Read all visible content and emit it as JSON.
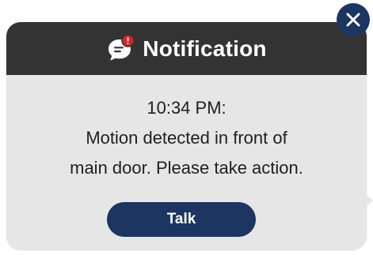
{
  "notification": {
    "title": "Notification",
    "time": "10:34 PM:",
    "message_lines": [
      "Motion detected in front of",
      "main door. Please take action."
    ],
    "talk_label": "Talk"
  },
  "icons": {
    "header": "chat-bubble-alert-icon",
    "close": "close-icon"
  },
  "colors": {
    "header_bg": "#333333",
    "body_bg": "#e6e6e6",
    "accent": "#1c3561",
    "alert_dot": "#d9232a"
  }
}
